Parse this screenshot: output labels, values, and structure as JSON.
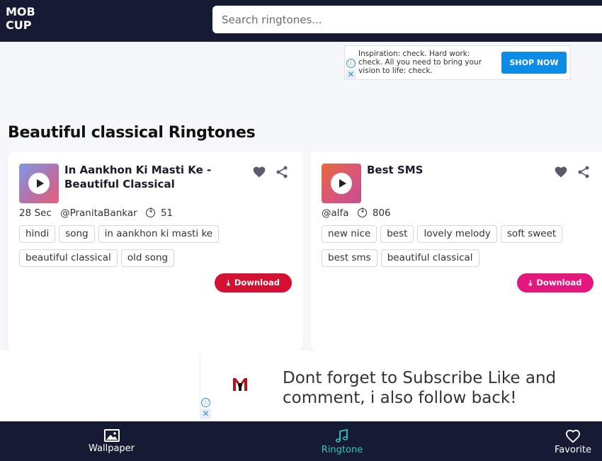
{
  "header": {
    "logo_line1": "MOB",
    "logo_line2": "CUP",
    "search_placeholder": "Search ringtones..."
  },
  "ad_top": {
    "text": "Inspiration: check. Hard work: check. All you need to bring your vision to life: check.",
    "button": "SHOP NOW",
    "info_icon": "ⓘ",
    "close_icon": "✕"
  },
  "page": {
    "title": "Beautiful classical Ringtones"
  },
  "cards": [
    {
      "title": "In Aankhon Ki Masti Ke - Beautiful Classical",
      "duration": "28 Sec",
      "user": "@PranitaBankar",
      "downloads": "51",
      "tags": [
        "hindi",
        "song",
        "in aankhon ki masti ke",
        "beautiful classical",
        "old song"
      ],
      "download_label": "Download",
      "button_color": "#d31132"
    },
    {
      "title": "Best SMS",
      "duration": "",
      "user": "@alfa",
      "downloads": "806",
      "tags": [
        "new nice",
        "best",
        "lovely melody",
        "soft sweet",
        "best sms",
        "beautiful classical"
      ],
      "download_label": "Download",
      "button_color": "#e3177d"
    }
  ],
  "ad_bottom": {
    "text": "Dont forget to Subscribe Like and comment, i also follow back!",
    "info_icon": "ⓘ",
    "close_icon": "✕"
  },
  "bottom_nav": {
    "items": [
      {
        "label": "Wallpaper",
        "icon": "image-icon"
      },
      {
        "label": "Ringtone",
        "icon": "music-note-icon",
        "active": true
      },
      {
        "label": "Favorite",
        "icon": "heart-icon"
      }
    ],
    "active_color": "#2fc7c4"
  },
  "colors": {
    "header_bg": "#171a33",
    "page_bg": "#f6f7fb"
  }
}
